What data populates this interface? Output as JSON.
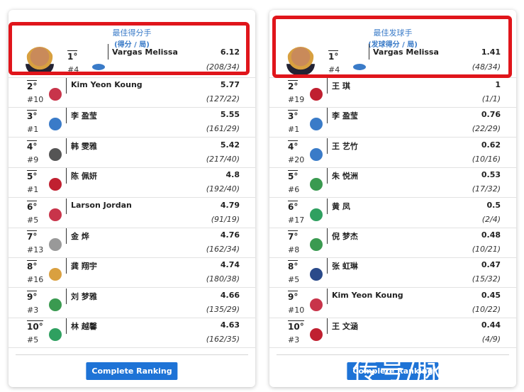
{
  "colors": {
    "accent": "#1e73d6",
    "highlight": "#e0151b"
  },
  "panels": [
    {
      "title": "最佳得分手",
      "subtitle": "(得分 / 局)",
      "button": "Complete Ranking",
      "rows": [
        {
          "rank": "1°",
          "num": "#4",
          "name": "Vargas Melissa",
          "value": "6.12",
          "fraction": "(208/34)",
          "logo": "#3a7bc8"
        },
        {
          "rank": "2°",
          "num": "#10",
          "name": "Kim Yeon Koung",
          "value": "5.77",
          "fraction": "(127/22)",
          "logo": "#c8344a"
        },
        {
          "rank": "3°",
          "num": "#1",
          "name": "李 盈莹",
          "value": "5.55",
          "fraction": "(161/29)",
          "logo": "#3a7bc8"
        },
        {
          "rank": "4°",
          "num": "#9",
          "name": "韩 雯雅",
          "value": "5.42",
          "fraction": "(217/40)",
          "logo": "#555555"
        },
        {
          "rank": "5°",
          "num": "#1",
          "name": "陈 佩妍",
          "value": "4.8",
          "fraction": "(192/40)",
          "logo": "#c02030"
        },
        {
          "rank": "6°",
          "num": "#5",
          "name": "Larson Jordan",
          "value": "4.79",
          "fraction": "(91/19)",
          "logo": "#c8344a"
        },
        {
          "rank": "7°",
          "num": "#13",
          "name": "金 烨",
          "value": "4.76",
          "fraction": "(162/34)",
          "logo": "#999999"
        },
        {
          "rank": "8°",
          "num": "#16",
          "name": "龚 翔宇",
          "value": "4.74",
          "fraction": "(180/38)",
          "logo": "#d9a040"
        },
        {
          "rank": "9°",
          "num": "#3",
          "name": "刘 梦雅",
          "value": "4.66",
          "fraction": "(135/29)",
          "logo": "#3a9a50"
        },
        {
          "rank": "10°",
          "num": "#5",
          "name": "林 越馨",
          "value": "4.63",
          "fraction": "(162/35)",
          "logo": "#2fa060"
        }
      ]
    },
    {
      "title": "最佳发球手",
      "subtitle": "(发球得分 / 局)",
      "button": "Complete Ranking",
      "rows": [
        {
          "rank": "1°",
          "num": "#4",
          "name": "Vargas Melissa",
          "value": "1.41",
          "fraction": "(48/34)",
          "logo": "#3a7bc8"
        },
        {
          "rank": "2°",
          "num": "#19",
          "name": "王 琪",
          "value": "1",
          "fraction": "(1/1)",
          "logo": "#c02030"
        },
        {
          "rank": "3°",
          "num": "#1",
          "name": "李 盈莹",
          "value": "0.76",
          "fraction": "(22/29)",
          "logo": "#3a7bc8"
        },
        {
          "rank": "4°",
          "num": "#20",
          "name": "王 艺竹",
          "value": "0.62",
          "fraction": "(10/16)",
          "logo": "#3a7bc8"
        },
        {
          "rank": "5°",
          "num": "#6",
          "name": "朱 悦洲",
          "value": "0.53",
          "fraction": "(17/32)",
          "logo": "#3a9a50"
        },
        {
          "rank": "6°",
          "num": "#17",
          "name": "黄 凤",
          "value": "0.5",
          "fraction": "(2/4)",
          "logo": "#2fa060"
        },
        {
          "rank": "7°",
          "num": "#8",
          "name": "倪 梦杰",
          "value": "0.48",
          "fraction": "(10/21)",
          "logo": "#3a9a50"
        },
        {
          "rank": "8°",
          "num": "#5",
          "name": "张 虹琳",
          "value": "0.47",
          "fraction": "(15/32)",
          "logo": "#2a4a8a"
        },
        {
          "rank": "9°",
          "num": "#10",
          "name": "Kim Yeon Koung",
          "value": "0.45",
          "fraction": "(10/22)",
          "logo": "#c8344a"
        },
        {
          "rank": "10°",
          "num": "#3",
          "name": "王 文涵",
          "value": "0.44",
          "fraction": "(4/9)",
          "logo": "#c02030"
        }
      ]
    }
  ],
  "watermark": "传号/脉"
}
